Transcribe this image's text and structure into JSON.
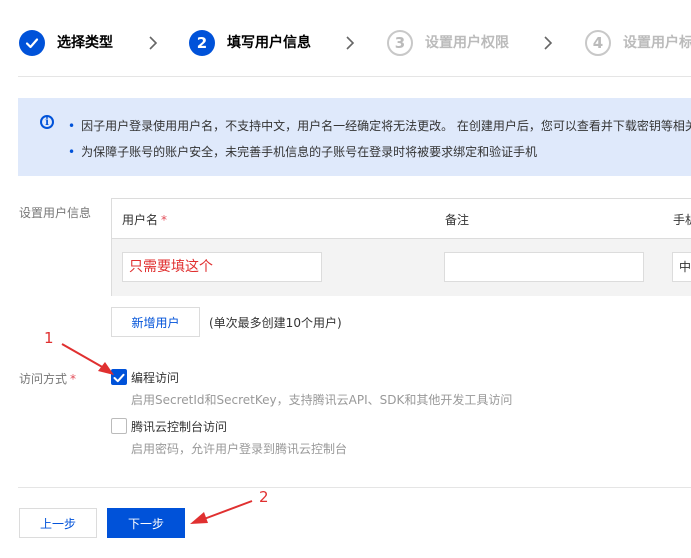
{
  "steps": [
    {
      "number": "",
      "label": "选择类型",
      "state": "done"
    },
    {
      "number": "2",
      "label": "填写用户信息",
      "state": "active"
    },
    {
      "number": "3",
      "label": "设置用户权限",
      "state": "todo"
    },
    {
      "number": "4",
      "label": "设置用户标",
      "state": "todo"
    }
  ],
  "banner": {
    "lines": [
      "因子用户登录使用用户名，不支持中文，用户名一经确定将无法更改。 在创建用户后，您可以查看并下载密钥等相关",
      "为保障子账号的账户安全，未完善手机信息的子账号在登录时将被要求绑定和验证手机"
    ]
  },
  "user_info": {
    "label": "设置用户信息",
    "columns": {
      "username": "用户名",
      "remark": "备注",
      "phone": "手机"
    },
    "row": {
      "username_value": "只需要填这个",
      "remark_value": "",
      "phone_prefix": "中"
    },
    "add_user_button": "新增用户",
    "add_user_hint": "(单次最多创建10个用户)"
  },
  "access": {
    "label": "访问方式",
    "options": [
      {
        "label": "编程访问",
        "desc": "启用SecretId和SecretKey，支持腾讯云API、SDK和其他开发工具访问",
        "checked": true
      },
      {
        "label": "腾讯云控制台访问",
        "desc": "启用密码，允许用户登录到腾讯云控制台",
        "checked": false
      }
    ]
  },
  "footer": {
    "prev_button": "上一步",
    "next_button": "下一步"
  },
  "annotations": {
    "one": "1",
    "two": "2"
  },
  "colors": {
    "primary": "#0052d9",
    "required": "#e34d59",
    "annotation": "#e03030",
    "banner_bg": "#dfe9fb"
  }
}
